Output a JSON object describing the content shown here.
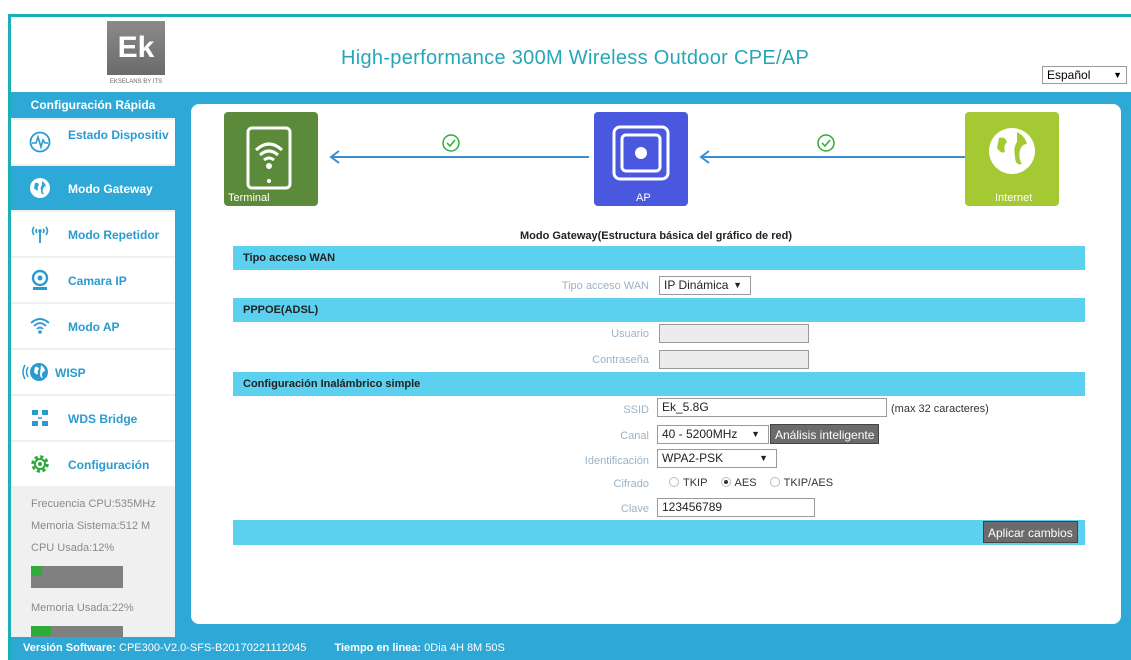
{
  "header": {
    "logo_text": "Ek",
    "logo_subtext": "EKSELANS BY ITS",
    "title": "High-performance  300M Wireless Outdoor CPE/AP",
    "language": "Español"
  },
  "sidebar": {
    "quick_config": "Configuración Rápida",
    "items": [
      {
        "label": "Estado Dispositiv",
        "icon": "pulse-icon"
      },
      {
        "label": "Modo Gateway",
        "icon": "globe-icon",
        "active": true
      },
      {
        "label": "Modo Repetidor",
        "icon": "antenna-icon"
      },
      {
        "label": "Camara IP",
        "icon": "camera-icon"
      },
      {
        "label": "Modo AP",
        "icon": "wifi-icon"
      },
      {
        "label": "WISP",
        "icon": "wisp-globe-icon"
      },
      {
        "label": "WDS Bridge",
        "icon": "wds-icon"
      },
      {
        "label": "Configuración",
        "icon": "gear-icon"
      }
    ],
    "stats": {
      "cpu_freq": "Frecuencia CPU:535MHz",
      "memory": "Memoria Sistema:512 M",
      "cpu_used": "CPU Usada:12%",
      "cpu_used_fraction": 0.12,
      "mem_used": "Memoria Usada:22%",
      "mem_used_fraction": 0.22
    }
  },
  "diagram": {
    "terminal": "Terminal",
    "ap": "AP",
    "internet": "Internet",
    "caption": "Modo Gateway(Estructura básica del gráfico de red)"
  },
  "wan": {
    "section": "Tipo acceso WAN",
    "label": "Tipo acceso WAN",
    "value": "IP Dinámica"
  },
  "pppoe": {
    "section": "PPPOE(ADSL)",
    "user_label": "Usuario",
    "user_value": "",
    "pass_label": "Contraseña",
    "pass_value": ""
  },
  "wireless": {
    "section": "Configuración Inalámbrico simple",
    "ssid_label": "SSID",
    "ssid_value": "Ek_5.8G",
    "ssid_hint": "(max 32 caracteres)",
    "channel_label": "Canal",
    "channel_value": "40 - 5200MHz",
    "smart_scan": "Análisis inteligente",
    "auth_label": "Identificación",
    "auth_value": "WPA2-PSK",
    "cipher_label": "Cifrado",
    "cipher_options": [
      "TKIP",
      "AES",
      "TKIP/AES"
    ],
    "cipher_selected": "AES",
    "key_label": "Clave",
    "key_value": "123456789"
  },
  "apply_button": "Aplicar cambios",
  "footer": {
    "version_label": "Versión Software",
    "version_value": "CPE300-V2.0-SFS-B20170221112045",
    "uptime_label": "Tiempo en linea",
    "uptime_value": "0Dia 4H 8M 50S"
  },
  "colors": {
    "accent": "#2ea8d6",
    "section_bar": "#5cd0ef",
    "terminal_tile": "#5b8a3a",
    "ap_tile": "#4a58e0",
    "internet_tile": "#a4c932"
  }
}
